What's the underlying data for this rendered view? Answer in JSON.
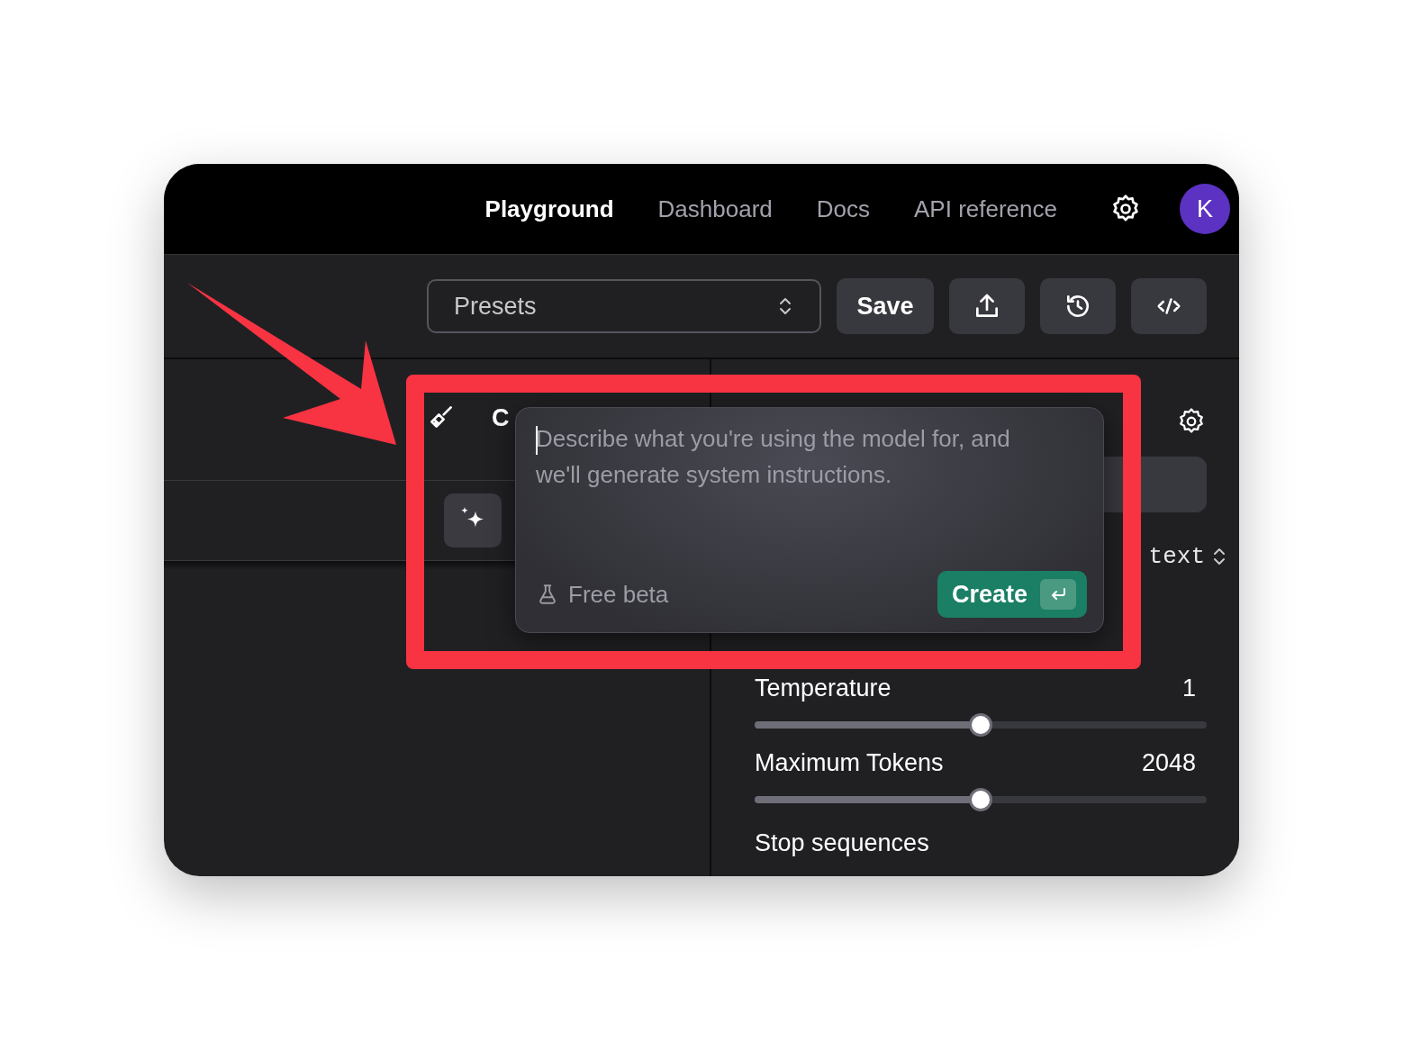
{
  "nav": {
    "tabs": [
      {
        "label": "Playground",
        "selected": true
      },
      {
        "label": "Dashboard",
        "selected": false
      },
      {
        "label": "Docs",
        "selected": false
      },
      {
        "label": "API reference",
        "selected": false
      }
    ],
    "avatar": "K"
  },
  "toolbar": {
    "presets": {
      "placeholder": "Presets"
    },
    "save": "Save"
  },
  "left_panel": {
    "heading": "C"
  },
  "generate_popup": {
    "placeholder": "Describe what you're using the model for, and we'll generate system instructions.",
    "note": "Free beta",
    "create": "Create"
  },
  "right_panel": {
    "mode": "text",
    "parameters": [
      {
        "label": "Temperature",
        "value": "1",
        "level": 0.5
      },
      {
        "label": "Maximum Tokens",
        "value": "2048",
        "level": 0.5
      }
    ],
    "stop_sequences": "Stop sequences"
  }
}
